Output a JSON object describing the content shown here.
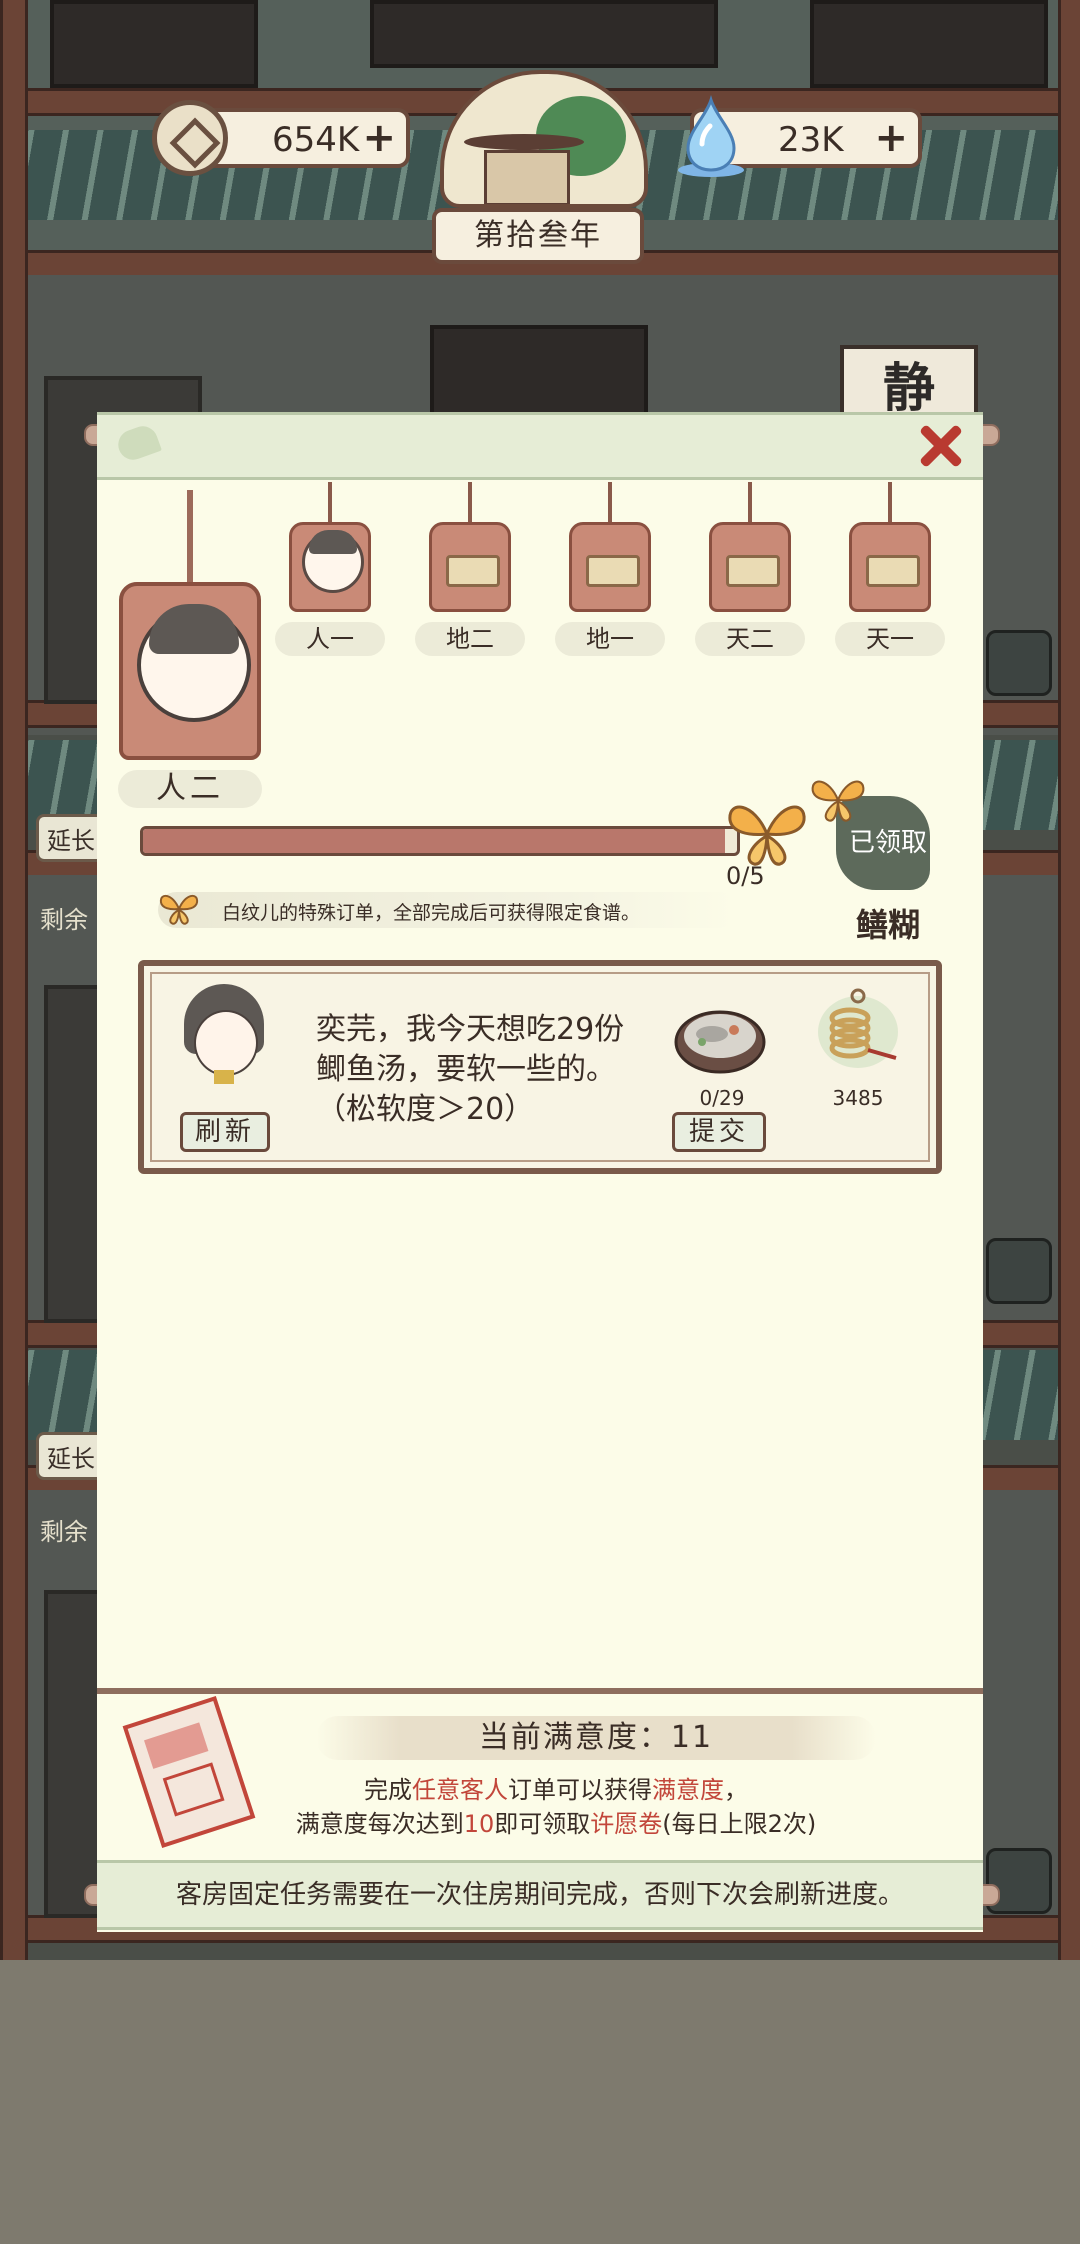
{
  "topbar": {
    "coins": "654K",
    "spirit": "23K",
    "plus": "+",
    "year": "第拾叁年"
  },
  "bg": {
    "sign": "静",
    "side_tag": "延长",
    "side_text": "剩余"
  },
  "stages": {
    "current": "人二",
    "list": [
      "人一",
      "地二",
      "地一",
      "天二",
      "天一"
    ]
  },
  "progress": {
    "current": 0,
    "total": 5,
    "text": "0/5",
    "claimed_label": "已领取",
    "reward_name": "鳝糊",
    "description": "白纹儿的特殊订单，全部完成后可获得限定食谱。"
  },
  "order": {
    "text": "奕芫，我今天想吃29份鲫鱼汤，要软一些的。（松软度＞20）",
    "refresh_label": "刷新",
    "submit_label": "提交",
    "dish_progress": "0/29",
    "reward_amount": "3485"
  },
  "satisfaction": {
    "title": "当前满意度：11",
    "line1_a": "完成",
    "line1_b": "任意客人",
    "line1_c": "订单可以获得",
    "line1_d": "满意度",
    "line1_e": "，",
    "line2_a": "满意度每次达到",
    "line2_b": "10",
    "line2_c": "即可领取",
    "line2_d": "许愿卷",
    "line2_e": "(每日上限2次)"
  },
  "footer": "客房固定任务需要在一次住房期间完成，否则下次会刷新进度。",
  "colors": {
    "accent_red": "#c2463a",
    "panel": "#fcfce8",
    "frame": "#6a4a3c"
  }
}
